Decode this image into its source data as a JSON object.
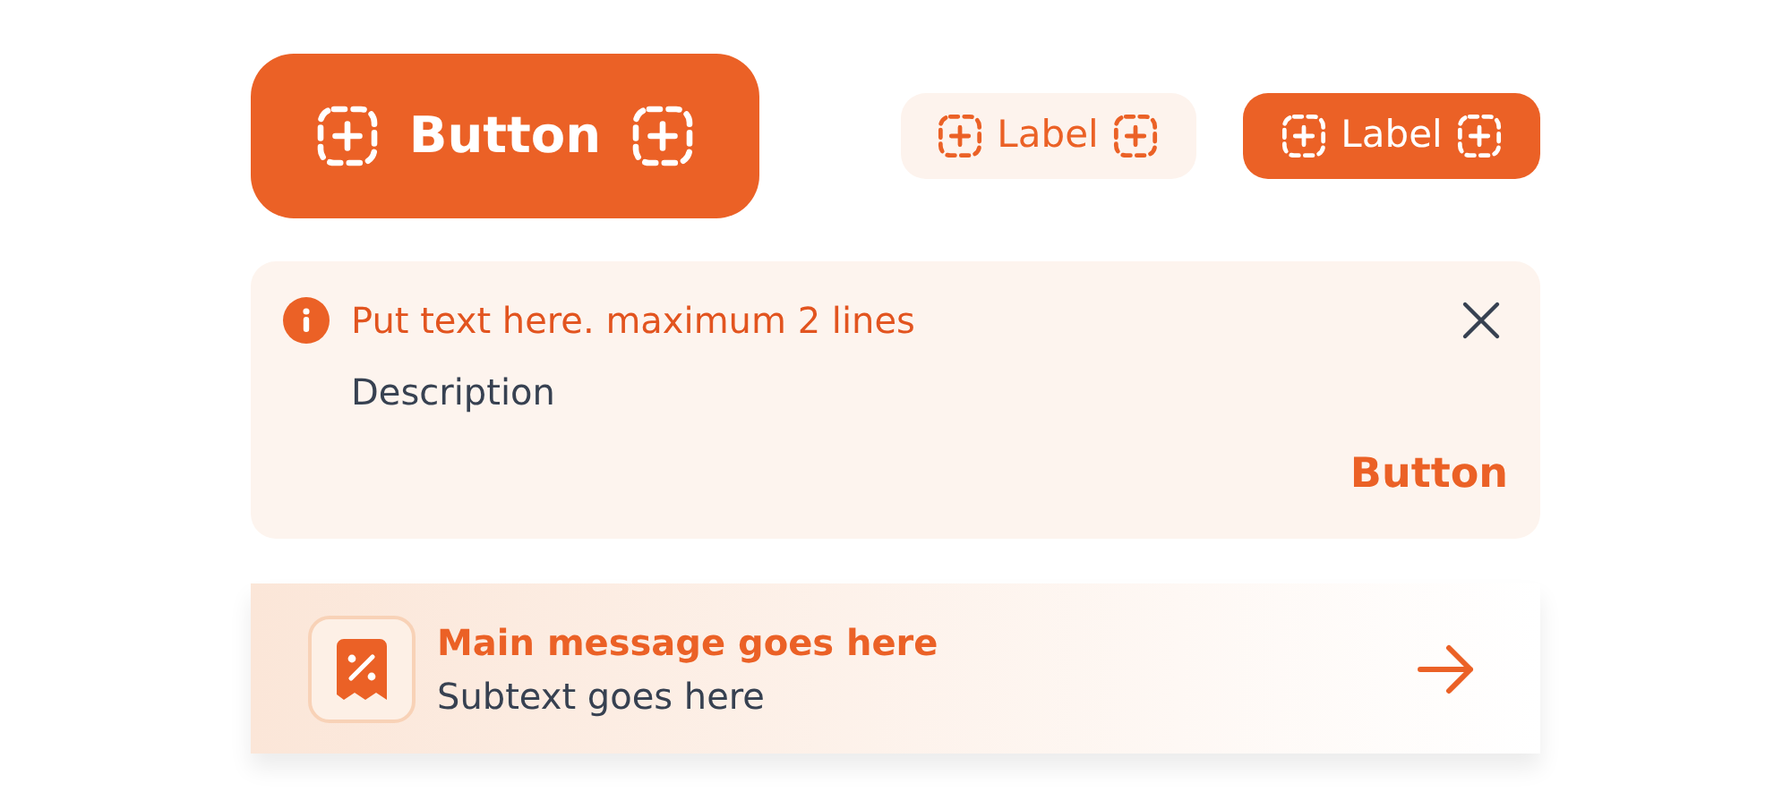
{
  "buttons": [
    {
      "label": "Button",
      "kind": "large"
    },
    {
      "label": "Label",
      "kind": "soft"
    },
    {
      "label": "Label",
      "kind": "solid"
    }
  ],
  "alert": {
    "title": "Put text here. maximum 2 lines",
    "description": "Description",
    "action": "Button"
  },
  "banner": {
    "message": "Main message goes here",
    "subtext": "Subtext goes here"
  }
}
